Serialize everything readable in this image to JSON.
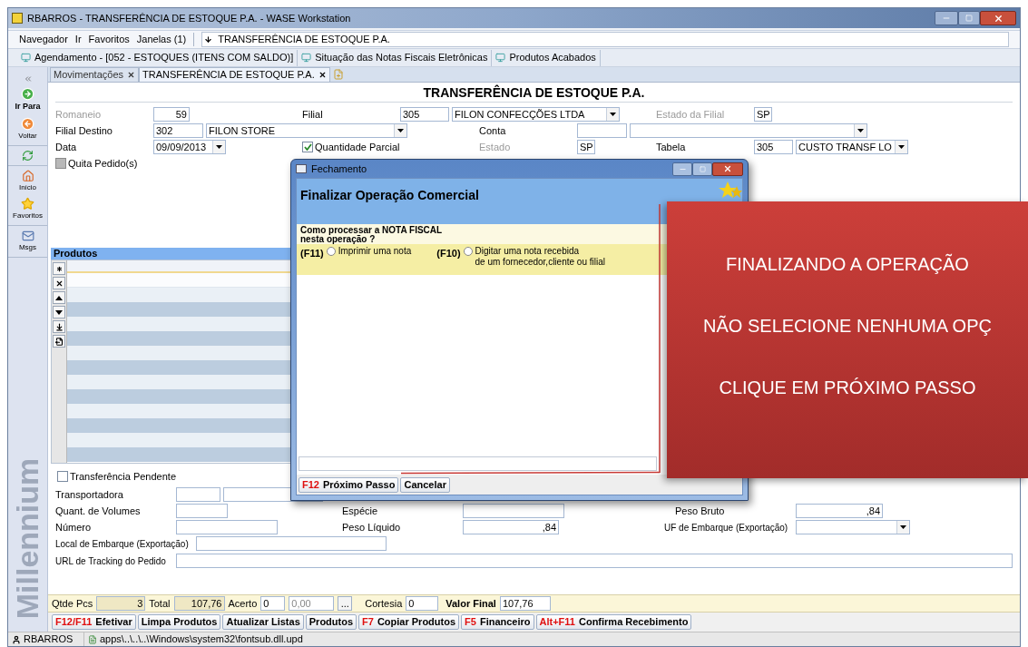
{
  "window": {
    "title": "RBARROS - TRANSFERÊNCIA DE ESTOQUE P.A. - WASE Workstation"
  },
  "menu": [
    "Navegador",
    "Ir",
    "Favoritos",
    "Janelas (1)"
  ],
  "address": "TRANSFERÊNCIA DE ESTOQUE P.A.",
  "bookmarks": [
    "Agendamento - [052 - ESTOQUES (ITENS COM SALDO)]",
    "Situação das Notas Fiscais Eletrônicas",
    "Produtos Acabados"
  ],
  "sidebar": {
    "items": [
      {
        "kind": "collapse"
      },
      {
        "kind": "go",
        "label": "Ir Para"
      },
      {
        "kind": "back",
        "label": "Voltar"
      },
      {
        "kind": "refresh"
      },
      {
        "kind": "home",
        "label": "Início"
      },
      {
        "kind": "favorites",
        "label": "Favoritos"
      },
      {
        "kind": "messages",
        "label": "Msgs"
      }
    ]
  },
  "brand": "Millennium",
  "tabs": [
    {
      "label": "Movimentações",
      "selected": false
    },
    {
      "label": "TRANSFERÊNCIA DE ESTOQUE P.A.",
      "selected": true
    }
  ],
  "form": {
    "title": "TRANSFERÊNCIA DE ESTOQUE P.A.",
    "romaneio": {
      "label": "Romaneio",
      "value": "59",
      "disabled": true
    },
    "filial": {
      "label": "Filial",
      "code": "305",
      "name": "FILON CONFECÇÕES LTDA",
      "disabled": false
    },
    "estado_filial": {
      "label": "Estado da Filial",
      "value": "SP",
      "disabled": true
    },
    "filial_destino": {
      "label": "Filial Destino",
      "code": "302",
      "name": "FILON STORE",
      "disabled": false
    },
    "conta": {
      "label": "Conta",
      "disabled": false
    },
    "data": {
      "label": "Data",
      "value": "09/09/2013",
      "disabled": false
    },
    "quantidade_parcial": {
      "label": "Quantidade Parcial",
      "checked": true,
      "disabled": false
    },
    "estado": {
      "label": "Estado",
      "value": "SP",
      "disabled": true
    },
    "tabela": {
      "label": "Tabela",
      "code": "305",
      "name": "CUSTO TRANSF LO",
      "disabled": false
    },
    "quita_pedido": {
      "label": "Quita Pedido(s)",
      "checked": false,
      "disabled": true
    }
  },
  "products": {
    "title": "Produtos",
    "tools": [
      {
        "kind": "new"
      },
      {
        "kind": "delete"
      },
      {
        "kind": "up"
      },
      {
        "kind": "down"
      },
      {
        "kind": "insert"
      },
      {
        "kind": "export"
      }
    ]
  },
  "shipping": {
    "transferencia_pendente": {
      "label": "Transferência Pendente",
      "checked": false,
      "disabled": false
    },
    "transportadora": {
      "label": "Transportadora"
    },
    "volumes": {
      "label": "Quant. de Volumes"
    },
    "numero": {
      "label": "Número"
    },
    "local_embarque": {
      "label": "Local de Embarque (Exportação)"
    },
    "url_tracking": {
      "label": "URL de Tracking do Pedido"
    },
    "especie": {
      "label": "Espécie"
    },
    "peso_liquido": {
      "label": "Peso Líquido",
      "value": ",84"
    },
    "peso_bruto": {
      "label": "Peso Bruto",
      "value": ",84"
    },
    "uf_embarque": {
      "label": "UF de Embarque (Exportação)"
    }
  },
  "totals": {
    "qtde_pcs": {
      "label": "Qtde Pcs",
      "value": "3"
    },
    "total": {
      "label": "Total",
      "value": "107,76"
    },
    "acerto": {
      "label": "Acerto",
      "value": "0",
      "amount": "0,00",
      "more": "..."
    },
    "cortesia": {
      "label": "Cortesia",
      "value": "0"
    },
    "valor_final": {
      "label": "Valor Final",
      "value": "107,76"
    }
  },
  "actions": [
    {
      "key": "F12/F11",
      "label": "Efetivar"
    },
    {
      "label": "Limpa Produtos"
    },
    {
      "label": "Atualizar Listas"
    },
    {
      "label": "Produtos"
    },
    {
      "key": "F7",
      "label": "Copiar Produtos"
    },
    {
      "key": "F5",
      "label": "Financeiro"
    },
    {
      "key": "Alt+F11",
      "label": "Confirma Recebimento"
    }
  ],
  "status_bar": {
    "user": "RBARROS",
    "file": "apps\\..\\..\\..\\Windows\\system32\\fontsub.dll.upd"
  },
  "dialog": {
    "title": "Fechamento",
    "heading": "Finalizar Operação Comercial",
    "question": "Como processar a NOTA FISCAL\nnesta operação ?",
    "options": [
      {
        "key": "(F11)",
        "label": "Imprimir uma nota",
        "selected": false
      },
      {
        "key": "(F10)",
        "label": "Digitar uma nota recebida\nde um fornecedor,cliente ou filial",
        "selected": false
      }
    ],
    "buttons": [
      {
        "key": "F12",
        "label": "Próximo Passo"
      },
      {
        "label": "Cancelar"
      }
    ]
  },
  "callout": {
    "lines": [
      "FINALIZANDO A OPERAÇÃO",
      "NÃO SELECIONE NENHUMA OPÇ",
      "CLIQUE EM PRÓXIMO PASSO"
    ]
  }
}
